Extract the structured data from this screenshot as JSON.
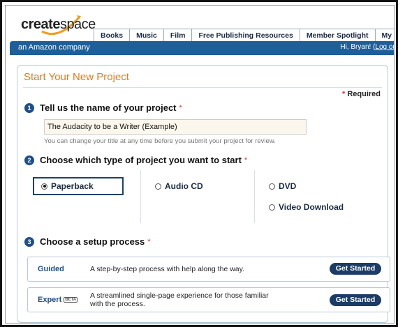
{
  "header": {
    "logo_text_create": "create",
    "logo_text_space": "space",
    "tagline": "an Amazon company",
    "greeting": "Hi, Bryan! (",
    "logout_link": "Log ou",
    "nav": [
      "Books",
      "Music",
      "Film",
      "Free Publishing Resources",
      "Member Spotlight",
      "My Accou"
    ]
  },
  "panel": {
    "title": "Start Your New Project",
    "required_star": "*",
    "required_label": "Required"
  },
  "step1": {
    "number": "1",
    "title": "Tell us the name of your project",
    "star": "*",
    "input_value": "The Audacity to be a Writer (Example)",
    "hint": "You can change your title at any time before you submit your project for review."
  },
  "step2": {
    "number": "2",
    "title": "Choose which type of project you want to start",
    "star": "*",
    "options": [
      "Paperback",
      "Audio CD",
      "DVD",
      "Video Download"
    ],
    "selected": "Paperback"
  },
  "step3": {
    "number": "3",
    "title": "Choose a setup process",
    "star": "*",
    "guided": {
      "label": "Guided",
      "description": "A step-by-step process with help along the way.",
      "button": "Get Started"
    },
    "expert": {
      "label": "Expert",
      "badge": "BETA",
      "description_line1": "A streamlined single-page experience for those familiar",
      "description_line2": "with the process.",
      "button": "Get Started"
    }
  },
  "colors": {
    "brand_orange": "#e07b1a",
    "brand_blue": "#1f5f99",
    "button_navy": "#1b3c66"
  }
}
